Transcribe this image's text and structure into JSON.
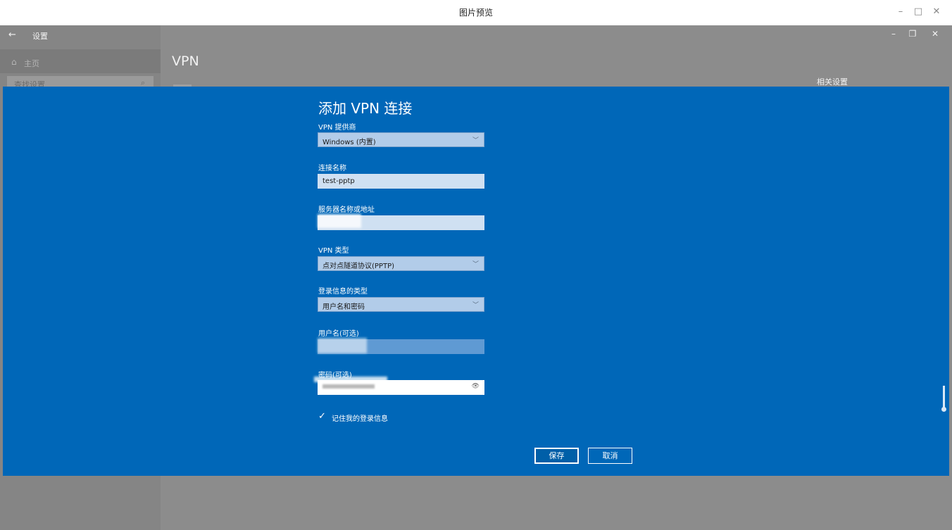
{
  "preview_window": {
    "title": "图片预览",
    "minimize_glyph": "–",
    "maximize_glyph": "□",
    "close_glyph": "✕"
  },
  "settings_window": {
    "back_glyph": "←",
    "title": "设置",
    "home_icon": "⌂",
    "home_label": "主页",
    "search_placeholder": "查找设置",
    "search_icon": "⌕",
    "heading": "VPN",
    "related_settings_title": "相关设置",
    "minimize_glyph": "–",
    "restore_glyph": "❐",
    "close_glyph": "✕"
  },
  "dialog": {
    "title": "添加 VPN 连接",
    "provider_label": "VPN 提供商",
    "provider_value": "Windows (内置)",
    "connection_name_label": "连接名称",
    "connection_name_value": "test-pptp",
    "server_label": "服务器名称或地址",
    "vpn_type_label": "VPN 类型",
    "vpn_type_value": "点对点隧道协议(PPTP)",
    "signin_type_label": "登录信息的类型",
    "signin_type_value": "用户名和密码",
    "username_label": "用户名(可选)",
    "password_label": "密码(可选)",
    "remember_label": "记住我的登录信息",
    "remember_checked": true,
    "save_label": "保存",
    "cancel_label": "取消",
    "chevron_glyph": "﹀",
    "check_glyph": "✓",
    "reveal_glyph": "👁"
  },
  "colors": {
    "dialog_bg": "#0067b8",
    "dim_overlay": "#8c8c8c"
  }
}
